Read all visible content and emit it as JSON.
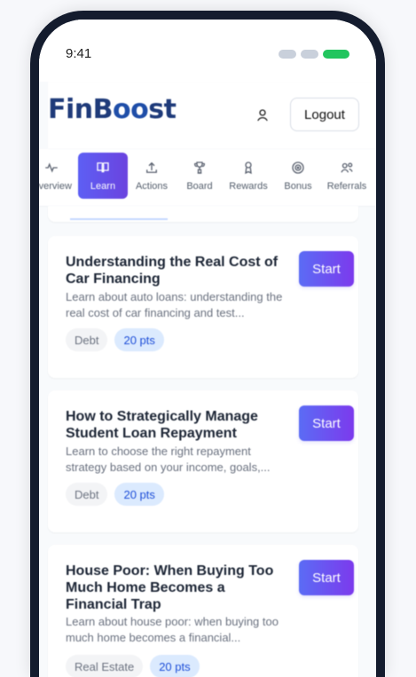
{
  "status": {
    "time": "9:41"
  },
  "header": {
    "logo_text_main": "FinB",
    "logo_text_accent": "oo",
    "logo_text_end": "st",
    "logout_label": "Logout"
  },
  "tabs": [
    {
      "label": "Overview",
      "icon": "activity-icon"
    },
    {
      "label": "Learn",
      "icon": "book-icon"
    },
    {
      "label": "Actions",
      "icon": "upload-icon"
    },
    {
      "label": "Board",
      "icon": "trophy-icon"
    },
    {
      "label": "Rewards",
      "icon": "award-icon"
    },
    {
      "label": "Bonus",
      "icon": "target-icon"
    },
    {
      "label": "Referrals",
      "icon": "users-icon"
    }
  ],
  "courses": [
    {
      "title": "Understanding the Real Cost of Car Financing",
      "description": "Learn about auto loans: understanding the real cost of car financing and test...",
      "category": "Debt",
      "points": "20 pts",
      "button_label": "Start"
    },
    {
      "title": "How to Strategically Manage Student Loan Repayment",
      "description": "Learn to choose the right repayment strategy based on your income, goals,...",
      "category": "Debt",
      "points": "20 pts",
      "button_label": "Start"
    },
    {
      "title": "House Poor: When Buying Too Much Home Becomes a Financial Trap",
      "description": "Learn about house poor: when buying too much home becomes a financial...",
      "category": "Real Estate",
      "points": "20 pts",
      "button_label": "Start"
    }
  ],
  "colors": {
    "accent_primary": "#5b6cf5",
    "accent_secondary": "#7c3aed",
    "success": "#22c55e",
    "frame": "#141c2e"
  }
}
